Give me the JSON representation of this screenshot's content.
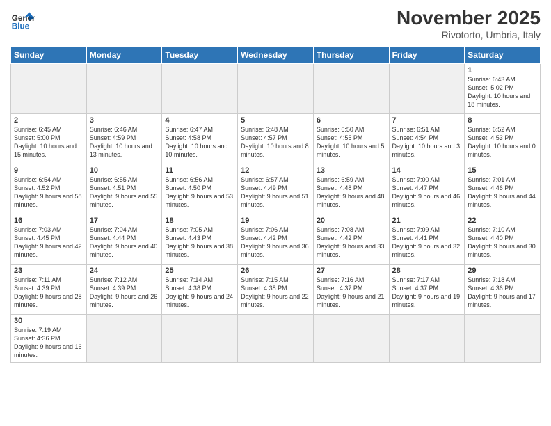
{
  "header": {
    "logo_general": "General",
    "logo_blue": "Blue",
    "month_title": "November 2025",
    "location": "Rivotorto, Umbria, Italy"
  },
  "weekdays": [
    "Sunday",
    "Monday",
    "Tuesday",
    "Wednesday",
    "Thursday",
    "Friday",
    "Saturday"
  ],
  "weeks": [
    [
      {
        "day": "",
        "info": "",
        "empty": true
      },
      {
        "day": "",
        "info": "",
        "empty": true
      },
      {
        "day": "",
        "info": "",
        "empty": true
      },
      {
        "day": "",
        "info": "",
        "empty": true
      },
      {
        "day": "",
        "info": "",
        "empty": true
      },
      {
        "day": "",
        "info": "",
        "empty": true
      },
      {
        "day": "1",
        "info": "Sunrise: 6:43 AM\nSunset: 5:02 PM\nDaylight: 10 hours and 18 minutes."
      }
    ],
    [
      {
        "day": "2",
        "info": "Sunrise: 6:45 AM\nSunset: 5:00 PM\nDaylight: 10 hours and 15 minutes."
      },
      {
        "day": "3",
        "info": "Sunrise: 6:46 AM\nSunset: 4:59 PM\nDaylight: 10 hours and 13 minutes."
      },
      {
        "day": "4",
        "info": "Sunrise: 6:47 AM\nSunset: 4:58 PM\nDaylight: 10 hours and 10 minutes."
      },
      {
        "day": "5",
        "info": "Sunrise: 6:48 AM\nSunset: 4:57 PM\nDaylight: 10 hours and 8 minutes."
      },
      {
        "day": "6",
        "info": "Sunrise: 6:50 AM\nSunset: 4:55 PM\nDaylight: 10 hours and 5 minutes."
      },
      {
        "day": "7",
        "info": "Sunrise: 6:51 AM\nSunset: 4:54 PM\nDaylight: 10 hours and 3 minutes."
      },
      {
        "day": "8",
        "info": "Sunrise: 6:52 AM\nSunset: 4:53 PM\nDaylight: 10 hours and 0 minutes."
      }
    ],
    [
      {
        "day": "9",
        "info": "Sunrise: 6:54 AM\nSunset: 4:52 PM\nDaylight: 9 hours and 58 minutes."
      },
      {
        "day": "10",
        "info": "Sunrise: 6:55 AM\nSunset: 4:51 PM\nDaylight: 9 hours and 55 minutes."
      },
      {
        "day": "11",
        "info": "Sunrise: 6:56 AM\nSunset: 4:50 PM\nDaylight: 9 hours and 53 minutes."
      },
      {
        "day": "12",
        "info": "Sunrise: 6:57 AM\nSunset: 4:49 PM\nDaylight: 9 hours and 51 minutes."
      },
      {
        "day": "13",
        "info": "Sunrise: 6:59 AM\nSunset: 4:48 PM\nDaylight: 9 hours and 48 minutes."
      },
      {
        "day": "14",
        "info": "Sunrise: 7:00 AM\nSunset: 4:47 PM\nDaylight: 9 hours and 46 minutes."
      },
      {
        "day": "15",
        "info": "Sunrise: 7:01 AM\nSunset: 4:46 PM\nDaylight: 9 hours and 44 minutes."
      }
    ],
    [
      {
        "day": "16",
        "info": "Sunrise: 7:03 AM\nSunset: 4:45 PM\nDaylight: 9 hours and 42 minutes."
      },
      {
        "day": "17",
        "info": "Sunrise: 7:04 AM\nSunset: 4:44 PM\nDaylight: 9 hours and 40 minutes."
      },
      {
        "day": "18",
        "info": "Sunrise: 7:05 AM\nSunset: 4:43 PM\nDaylight: 9 hours and 38 minutes."
      },
      {
        "day": "19",
        "info": "Sunrise: 7:06 AM\nSunset: 4:42 PM\nDaylight: 9 hours and 36 minutes."
      },
      {
        "day": "20",
        "info": "Sunrise: 7:08 AM\nSunset: 4:42 PM\nDaylight: 9 hours and 33 minutes."
      },
      {
        "day": "21",
        "info": "Sunrise: 7:09 AM\nSunset: 4:41 PM\nDaylight: 9 hours and 32 minutes."
      },
      {
        "day": "22",
        "info": "Sunrise: 7:10 AM\nSunset: 4:40 PM\nDaylight: 9 hours and 30 minutes."
      }
    ],
    [
      {
        "day": "23",
        "info": "Sunrise: 7:11 AM\nSunset: 4:39 PM\nDaylight: 9 hours and 28 minutes."
      },
      {
        "day": "24",
        "info": "Sunrise: 7:12 AM\nSunset: 4:39 PM\nDaylight: 9 hours and 26 minutes."
      },
      {
        "day": "25",
        "info": "Sunrise: 7:14 AM\nSunset: 4:38 PM\nDaylight: 9 hours and 24 minutes."
      },
      {
        "day": "26",
        "info": "Sunrise: 7:15 AM\nSunset: 4:38 PM\nDaylight: 9 hours and 22 minutes."
      },
      {
        "day": "27",
        "info": "Sunrise: 7:16 AM\nSunset: 4:37 PM\nDaylight: 9 hours and 21 minutes."
      },
      {
        "day": "28",
        "info": "Sunrise: 7:17 AM\nSunset: 4:37 PM\nDaylight: 9 hours and 19 minutes."
      },
      {
        "day": "29",
        "info": "Sunrise: 7:18 AM\nSunset: 4:36 PM\nDaylight: 9 hours and 17 minutes."
      }
    ],
    [
      {
        "day": "30",
        "info": "Sunrise: 7:19 AM\nSunset: 4:36 PM\nDaylight: 9 hours and 16 minutes."
      },
      {
        "day": "",
        "info": "",
        "empty": true
      },
      {
        "day": "",
        "info": "",
        "empty": true
      },
      {
        "day": "",
        "info": "",
        "empty": true
      },
      {
        "day": "",
        "info": "",
        "empty": true
      },
      {
        "day": "",
        "info": "",
        "empty": true
      },
      {
        "day": "",
        "info": "",
        "empty": true
      }
    ]
  ]
}
